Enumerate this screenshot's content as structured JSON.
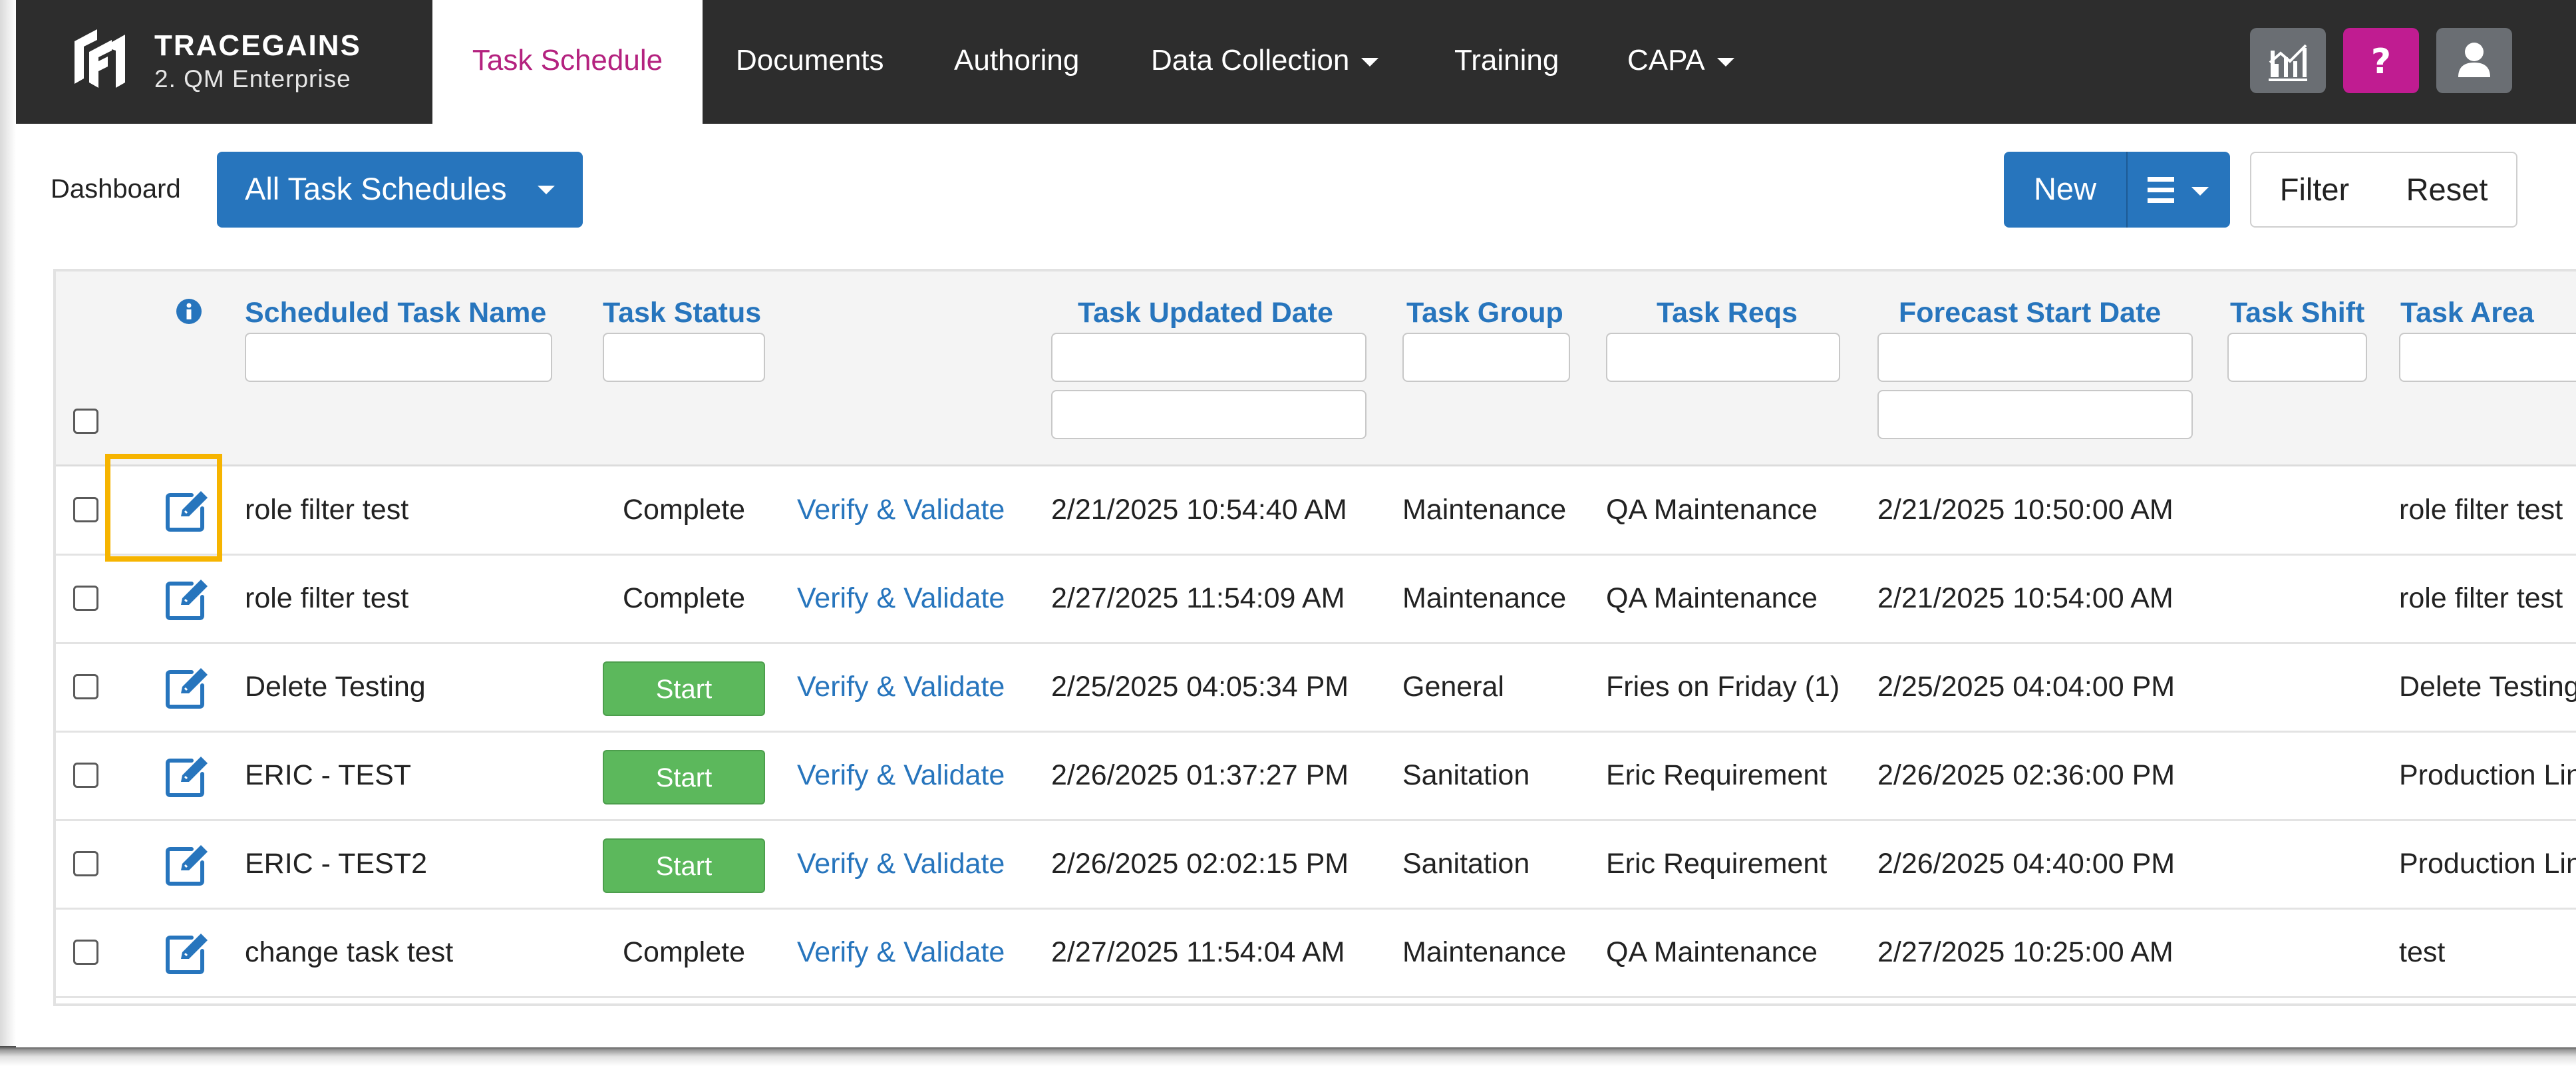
{
  "brand": {
    "name": "TRACEGAINS",
    "subtitle": "2. QM Enterprise"
  },
  "nav": {
    "items": [
      {
        "label": "Task Schedule",
        "active": true
      },
      {
        "label": "Documents"
      },
      {
        "label": "Authoring"
      },
      {
        "label": "Data Collection",
        "dropdown": true
      },
      {
        "label": "Training"
      },
      {
        "label": "CAPA",
        "dropdown": true
      }
    ],
    "buttons": [
      {
        "icon": "analytics-chart-icon"
      },
      {
        "icon": "help-question-icon"
      },
      {
        "icon": "user-profile-icon"
      }
    ]
  },
  "toolbar": {
    "breadcrumb": "Dashboard",
    "schedule_select": "All Task Schedules",
    "new_label": "New",
    "filter_label": "Filter",
    "reset_label": "Reset"
  },
  "table": {
    "columns": [
      "Scheduled Task Name",
      "Task Status",
      "Task Updated Date",
      "Task Group",
      "Task Reqs",
      "Forecast Start Date",
      "Task Shift",
      "Task Area"
    ],
    "rows": [
      {
        "name": "role filter test",
        "status": "Complete",
        "status_button": false,
        "link": "Verify & Validate",
        "updated": "2/21/2025 10:54:40 AM",
        "group": "Maintenance",
        "reqs": "QA Maintenance",
        "forecast": "2/21/2025 10:50:00 AM",
        "shift": "",
        "area": "role filter test"
      },
      {
        "name": "role filter test",
        "status": "Complete",
        "status_button": false,
        "link": "Verify & Validate",
        "updated": "2/27/2025 11:54:09 AM",
        "group": "Maintenance",
        "reqs": "QA Maintenance",
        "forecast": "2/21/2025 10:54:00 AM",
        "shift": "",
        "area": "role filter test"
      },
      {
        "name": "Delete Testing",
        "status": "Start",
        "status_button": true,
        "link": "Verify & Validate",
        "updated": "2/25/2025 04:05:34 PM",
        "group": "General",
        "reqs": "Fries on Friday (1)",
        "forecast": "2/25/2025 04:04:00 PM",
        "shift": "",
        "area": "Delete Testing"
      },
      {
        "name": "ERIC - TEST",
        "status": "Start",
        "status_button": true,
        "link": "Verify & Validate",
        "updated": "2/26/2025 01:37:27 PM",
        "group": "Sanitation",
        "reqs": "Eric Requirement",
        "forecast": "2/26/2025 02:36:00 PM",
        "shift": "",
        "area": "Production Lin"
      },
      {
        "name": "ERIC - TEST2",
        "status": "Start",
        "status_button": true,
        "link": "Verify & Validate",
        "updated": "2/26/2025 02:02:15 PM",
        "group": "Sanitation",
        "reqs": "Eric Requirement",
        "forecast": "2/26/2025 04:40:00 PM",
        "shift": "",
        "area": "Production Lin"
      },
      {
        "name": "change task test",
        "status": "Complete",
        "status_button": false,
        "link": "Verify & Validate",
        "updated": "2/27/2025 11:54:04 AM",
        "group": "Maintenance",
        "reqs": "QA Maintenance",
        "forecast": "2/27/2025 10:25:00 AM",
        "shift": "",
        "area": "test"
      }
    ]
  },
  "colors": {
    "nav_bg": "#2d2d2d",
    "active_tab": "#b4227f",
    "primary": "#2775bd",
    "success": "#5cb85c",
    "help": "#c01c91",
    "highlight": "#f6b400"
  }
}
